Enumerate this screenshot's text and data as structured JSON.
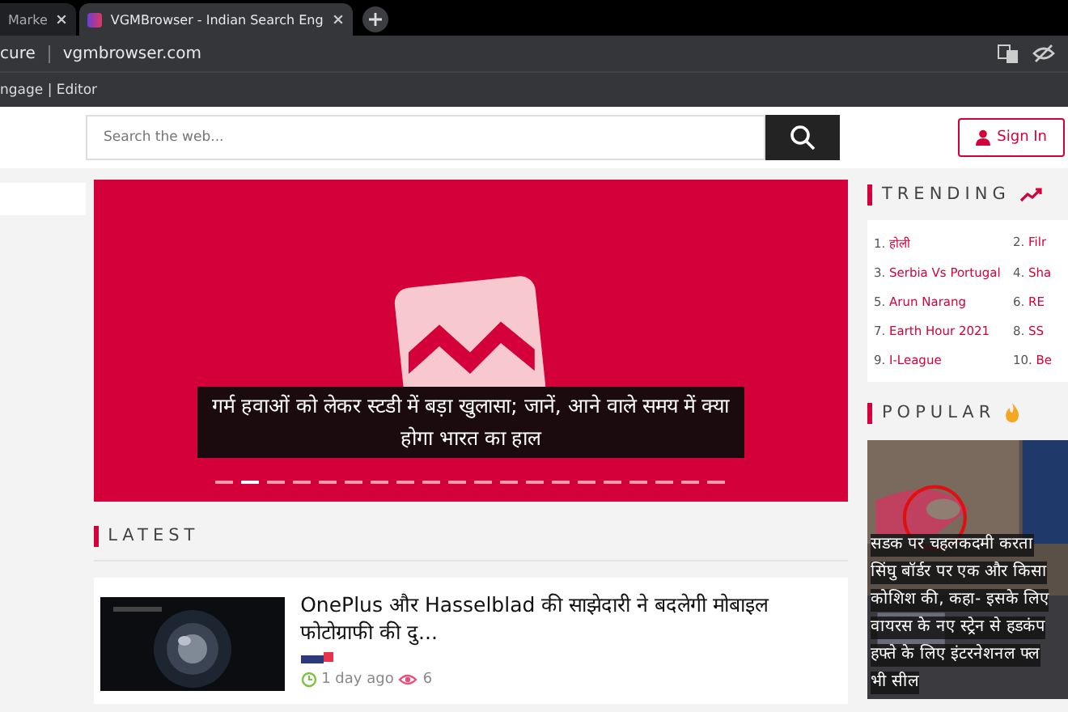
{
  "browser": {
    "tabs": [
      {
        "title": "Marke",
        "selected": false
      },
      {
        "title": "VGMBrowser - Indian Search Eng",
        "selected": true
      }
    ],
    "address": {
      "security": "cure",
      "url": "vgmbrowser.com"
    },
    "bookmarks": [
      "ngage | Editor"
    ]
  },
  "header": {
    "search": {
      "placeholder": "Search the web..."
    },
    "sign_in": "Sign In"
  },
  "hero": {
    "headline": "गर्म हवाओं को लेकर स्टडी में बड़ा खुलासा; जानें, आने वाले समय में क्या होगा भारत का हाल",
    "slides": [
      {
        "selected": false
      },
      {
        "selected": true
      },
      {
        "selected": false
      },
      {
        "selected": false
      },
      {
        "selected": false
      },
      {
        "selected": false
      },
      {
        "selected": false
      },
      {
        "selected": false
      },
      {
        "selected": false
      },
      {
        "selected": false
      },
      {
        "selected": false
      },
      {
        "selected": false
      },
      {
        "selected": false
      },
      {
        "selected": false
      },
      {
        "selected": false
      },
      {
        "selected": false
      },
      {
        "selected": false
      },
      {
        "selected": false
      },
      {
        "selected": false
      },
      {
        "selected": false
      }
    ]
  },
  "latest": {
    "title": "LATEST",
    "articles": [
      {
        "title": "OnePlus और Hasselblad की साझेदारी ने बदलेगी मोबाइल फोटोग्राफी की दु...",
        "time": "1 day ago",
        "views": "6"
      }
    ]
  },
  "trending": {
    "title": "TRENDING",
    "items": [
      {
        "rank": "1.",
        "label": "होली"
      },
      {
        "rank": "2.",
        "label": "Filr"
      },
      {
        "rank": "3.",
        "label": "Serbia Vs Portugal"
      },
      {
        "rank": "4.",
        "label": "Sha"
      },
      {
        "rank": "5.",
        "label": "Arun Narang"
      },
      {
        "rank": "6.",
        "label": "RE"
      },
      {
        "rank": "7.",
        "label": "Earth Hour 2021"
      },
      {
        "rank": "8.",
        "label": "SS"
      },
      {
        "rank": "9.",
        "label": "I-League"
      },
      {
        "rank": "10.",
        "label": "Be"
      }
    ]
  },
  "popular": {
    "title": "POPULAR",
    "captions": [
      "सडक पर चहलकदमी करता",
      "सिंघु बॉर्डर पर एक और किसा",
      "कोशिश की, कहा- इसके लिए",
      "वायरस के नए स्ट्रेन से हडकंप",
      "हफ्ते के लिए इंटरनेशनल फ्ल",
      "भी सील"
    ]
  }
}
